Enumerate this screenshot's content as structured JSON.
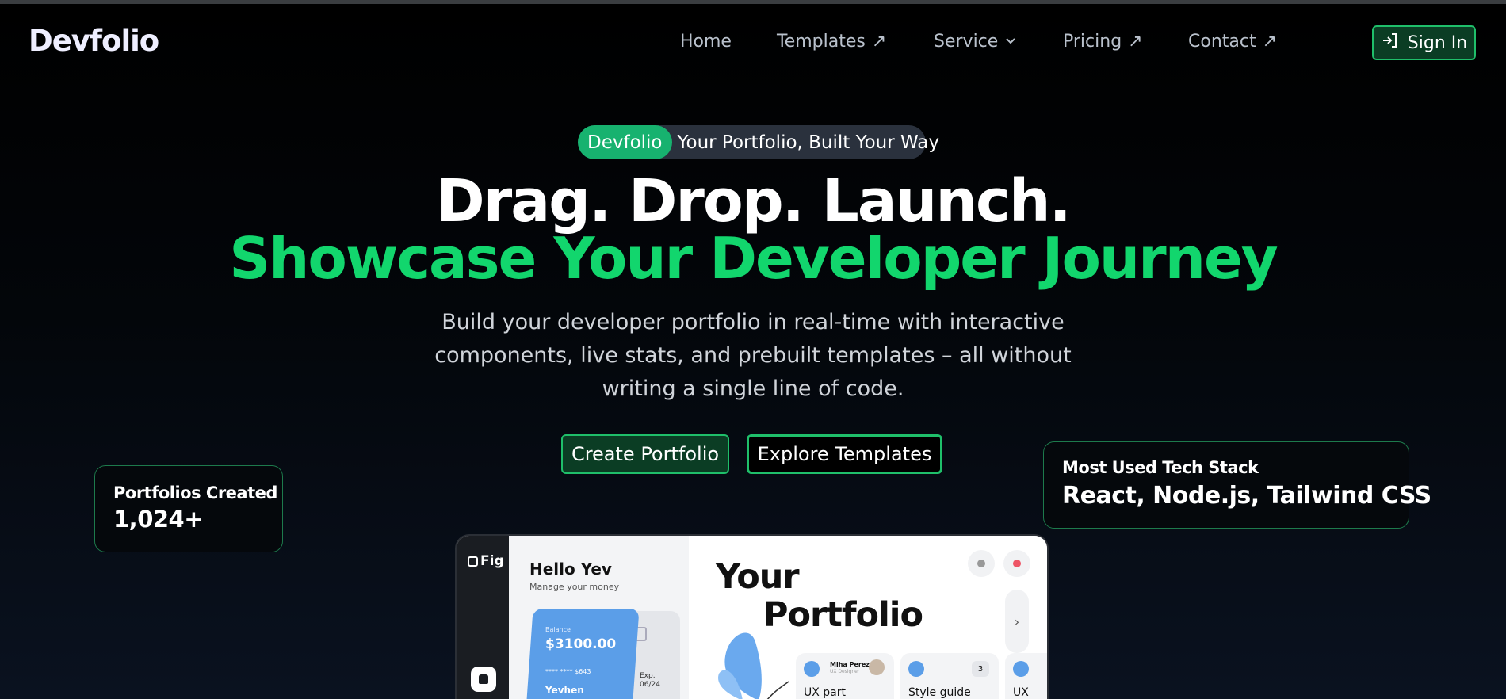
{
  "header": {
    "logo": "Devfolio",
    "nav": [
      {
        "label": "Home",
        "icon": ""
      },
      {
        "label": "Templates",
        "icon": "↗"
      },
      {
        "label": "Service",
        "icon": "⌄"
      },
      {
        "label": "Pricing",
        "icon": "↗"
      },
      {
        "label": "Contact",
        "icon": "↗"
      }
    ],
    "signin_label": "Sign In"
  },
  "hero": {
    "badge_pill": "Devfolio",
    "badge_text": "Your Portfolio, Built Your Way",
    "title_line1": "Drag. Drop. Launch.",
    "title_line2": "Showcase Your Developer Journey",
    "subtitle_line1": "Build your developer portfolio in real-time with interactive",
    "subtitle_line2": "components, live stats, and prebuilt templates – all without",
    "subtitle_line3": "writing a single line of code.",
    "create_button": "Create Portfolio",
    "explore_button": "Explore Templates"
  },
  "stats": {
    "portfolios_label": "Portfolios Created",
    "portfolios_value": "1,024+",
    "tech_label": "Most Used Tech Stack",
    "tech_value": "React, Node.js, Tailwind CSS"
  },
  "preview": {
    "fig_label": "Fig",
    "hello": "Hello Yev",
    "manage": "Manage your money",
    "balance_label": "Balance",
    "balance": "$3100.00",
    "card_number": "**** **** $643",
    "card_name": "Yevhen",
    "exp_label": "Exp.",
    "exp_date": "06/24",
    "heading_line1": "Your",
    "heading_line2": "Portfolio",
    "person_name": "Miha Perez",
    "person_role": "UX Designer",
    "tile1": "UX part",
    "tile2": "Style guide",
    "tile2_count": "3",
    "tile3": "UX"
  },
  "colors": {
    "accent": "#12d66d",
    "button_bg": "#0b3d24",
    "button_border": "#1fbf6a",
    "badge_bg": "#2a313d",
    "badge_pill": "#17b26f",
    "card_blue": "#5b9ee8"
  }
}
